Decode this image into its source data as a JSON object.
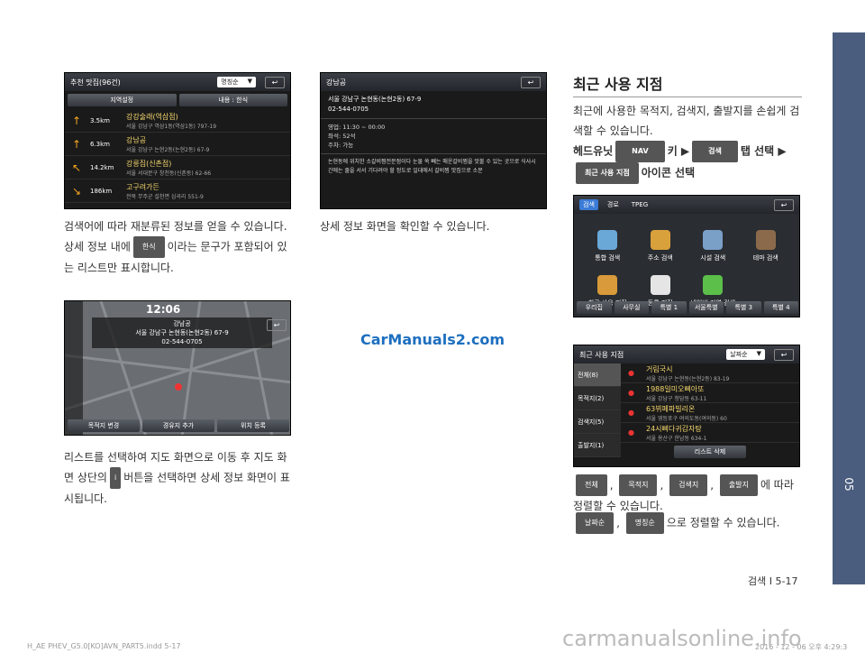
{
  "chapter_tab": "05",
  "footer": {
    "page": "검색 I 5-17",
    "file": "H_AE PHEV_G5.0[KO]AVN_PART5.indd   5-17",
    "date": "2016 - 12 - 06   오후 4:29:3",
    "watermark_top": "CarManuals2.com",
    "watermark_bottom": "carmanualsonline.info"
  },
  "s1": {
    "title": "추천 맛집(96건)",
    "sort": "명칭순",
    "btn1": "지역설정",
    "btn2": "내용 : 한식",
    "rows": [
      {
        "dist": "3.5km",
        "name": "강강술래(역삼점)",
        "addr": "서울 강남구 역삼1동(역삼1동) 797-19",
        "arrow": "↑"
      },
      {
        "dist": "6.3km",
        "name": "강남공",
        "addr": "서울 강남구 논현2동(논현2동) 67-9",
        "arrow": "↑"
      },
      {
        "dist": "14.2km",
        "name": "강릉집(신촌점)",
        "addr": "서울 서대문구 창천동(신촌동) 62-66",
        "arrow": "↖"
      },
      {
        "dist": "186km",
        "name": "고구려가든",
        "addr": "전북 무주군 설천면 심곡리 551-9",
        "arrow": "↘"
      }
    ]
  },
  "s2": {
    "title": "강남공",
    "addr": "서울 강남구 논현동(논현2동) 67-9",
    "tel": "02-544-0705",
    "info": [
      "영업: 11:30 ~ 00:00",
      "좌석: 52석",
      "주차: 가능"
    ],
    "desc": "논현동에 위치한 소갈비찜전문점이다 눈물 쏙 빼는 매운갈비찜을 맛볼 수 있는 곳으로 식사시간에는 줄을 서서 기다려야 할 정도로 일대에서 갈비찜 맛집으로 소문"
  },
  "left_text": {
    "p1": "검색어에 따라 재분류된 정보를 얻을 수 있습니다.",
    "p2a": "상세 정보 내에",
    "p2_pill": "한식",
    "p2b": "이라는 문구가 포함되어 있는 리스트만 표시합니다.",
    "p3a": "리스트를 선택하여 지도 화면으로 이동 후 지도 화면 상단의",
    "p3b": "버튼을 선택하면 상세 정보 화면이 표시됩니다."
  },
  "mid_text": "상세 정보 화면을 확인할 수 있습니다.",
  "map": {
    "time": "12:06",
    "name": "강남공",
    "addr": "서울 강남구 논현동(논현2동) 67-9",
    "tel": "02-544-0705",
    "btns": [
      "목적지 변경",
      "경유지 추가",
      "위치 등록"
    ]
  },
  "right": {
    "heading": "최근 사용 지점",
    "p1": "최근에 사용한 목적지, 검색지, 출발지를 손쉽게 검색할 수 있습니다.",
    "step_a": "헤드유닛",
    "pill_nav": "NAV",
    "step_b": "키 ▶",
    "pill_search": "검색",
    "step_c": "탭 선택 ▶",
    "pill_recent": "최근 사용 지점",
    "step_d": "아이콘 선택",
    "filters": [
      "전체",
      "목적지",
      "검색지",
      "출발지"
    ],
    "filter_tail": "에 따라 정렬할 수 있습니다.",
    "sorts": [
      "날짜순",
      "명칭순"
    ],
    "sort_tail": "으로 정렬할 수 있습니다."
  },
  "s3": {
    "tabs": [
      "검색",
      "경로",
      "TPEG"
    ],
    "icons": [
      "통합 검색",
      "주소 검색",
      "시설 검색",
      "테마 검색",
      "최근 사용 지점",
      "등록 지점",
      "네이버 지역 검색",
      ""
    ],
    "bottom": [
      "우리집",
      "사무실",
      "특별 1",
      "서울특별",
      "특별 3",
      "특별 4"
    ]
  },
  "s4": {
    "title": "최근 사용 지점",
    "sort": "날짜순",
    "side": [
      "전체(8)",
      "목적지(2)",
      "검색지(5)",
      "출발지(1)"
    ],
    "rows": [
      {
        "name": "거림국시",
        "addr": "서울 강남구 논현동(논현2동) 83-19"
      },
      {
        "name": "1988일미오삐아또",
        "addr": "서울 강남구 청담동 63-11"
      },
      {
        "name": "63뷔페파빌리온",
        "addr": "서울 영등포구 여의도동(여의동) 60"
      },
      {
        "name": "24시삐다귀감자탕",
        "addr": "서울 용산구 한남동 634-1"
      }
    ],
    "delete": "리스트 삭제"
  }
}
